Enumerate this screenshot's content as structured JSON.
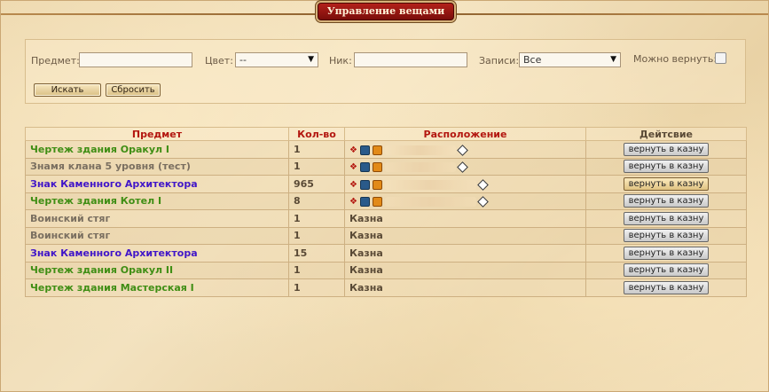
{
  "window": {
    "title": "Управление вещами"
  },
  "filters": {
    "item_label": "Предмет:",
    "item_value": "",
    "color_label": "Цвет:",
    "color_value": "--",
    "nick_label": "Ник:",
    "nick_value": "",
    "records_label": "Записи:",
    "records_value": "Все",
    "returnable_label": "Можно вернуть:",
    "returnable_checked": false,
    "search_label": "Искать",
    "reset_label": "Сбросить"
  },
  "table": {
    "headers": [
      "Предмет",
      "Кол-во",
      "Расположение",
      "Дейтсвие"
    ],
    "rows": [
      {
        "item": "Чертеж здания Оракул I",
        "color": "green",
        "qty": "1",
        "location": "",
        "loc_type": "player",
        "action": "вернуть в казну"
      },
      {
        "item": "Знамя клана 5 уровня (тест)",
        "color": "gray",
        "qty": "1",
        "location": "",
        "loc_type": "player",
        "action": "вернуть в казну"
      },
      {
        "item": "Знак Каменного Архитектора",
        "color": "blue",
        "qty": "965",
        "location": "",
        "loc_type": "player-wide",
        "action": "вернуть в казну"
      },
      {
        "item": "Чертеж здания Котел I",
        "color": "green",
        "qty": "8",
        "location": "",
        "loc_type": "player-wide",
        "action": "вернуть в казну"
      },
      {
        "item": "Воинский стяг",
        "color": "gray",
        "qty": "1",
        "location": "Казна",
        "loc_type": "treasury",
        "action": "вернуть в казну"
      },
      {
        "item": "Воинский стяг",
        "color": "gray",
        "qty": "1",
        "location": "Казна",
        "loc_type": "treasury",
        "action": "вернуть в казну"
      },
      {
        "item": "Знак Каменного Архитектора",
        "color": "blue",
        "qty": "15",
        "location": "Казна",
        "loc_type": "treasury",
        "action": "вернуть в казну"
      },
      {
        "item": "Чертеж здания Оракул II",
        "color": "green",
        "qty": "1",
        "location": "Казна",
        "loc_type": "treasury",
        "action": "вернуть в казну"
      },
      {
        "item": "Чертеж здания Мастерская I",
        "color": "green",
        "qty": "1",
        "location": "Казна",
        "loc_type": "treasury",
        "action": "вернуть в казну"
      }
    ]
  },
  "icons": [
    "arrow-icon",
    "fist-icon",
    "crown-icon",
    "info-icon"
  ],
  "colors": {
    "title_bg": "#9b1610",
    "header_text": "#b3160f",
    "green": "#3f8e14",
    "gray": "#7a6f60",
    "blue": "#4116c8"
  }
}
